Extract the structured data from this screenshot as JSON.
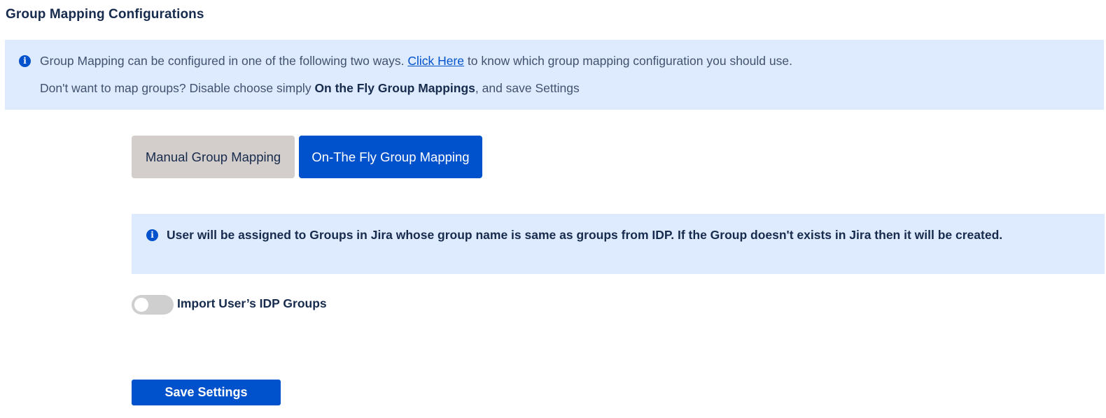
{
  "page": {
    "title": "Group Mapping Configurations"
  },
  "info_banner": {
    "icon": "info-icon",
    "line1_prefix": "Group Mapping can be configured in one of the following two ways. ",
    "line1_link": "Click Here",
    "line1_suffix": " to know which group mapping configuration you should use.",
    "line2_prefix": "Don't want to map groups? Disable choose simply ",
    "line2_bold": "On the Fly Group Mappings",
    "line2_suffix": ", and save Settings"
  },
  "tabs": [
    {
      "label": "Manual Group Mapping",
      "active": false
    },
    {
      "label": "On-The Fly Group Mapping",
      "active": true
    }
  ],
  "description": {
    "icon": "info-icon",
    "text": "User will be assigned to Groups in Jira whose group name is same as groups from IDP. If the Group doesn't exists in Jira then it will be created."
  },
  "import_toggle": {
    "label": "Import User’s IDP Groups",
    "enabled": false
  },
  "save_button": {
    "label": "Save Settings"
  },
  "colors": {
    "primary": "#0052cc",
    "banner_bg": "#deebff",
    "inactive_tab_bg": "#d3cecc",
    "toggle_off_bg": "#cfcfcf",
    "text": "#172b4d"
  }
}
